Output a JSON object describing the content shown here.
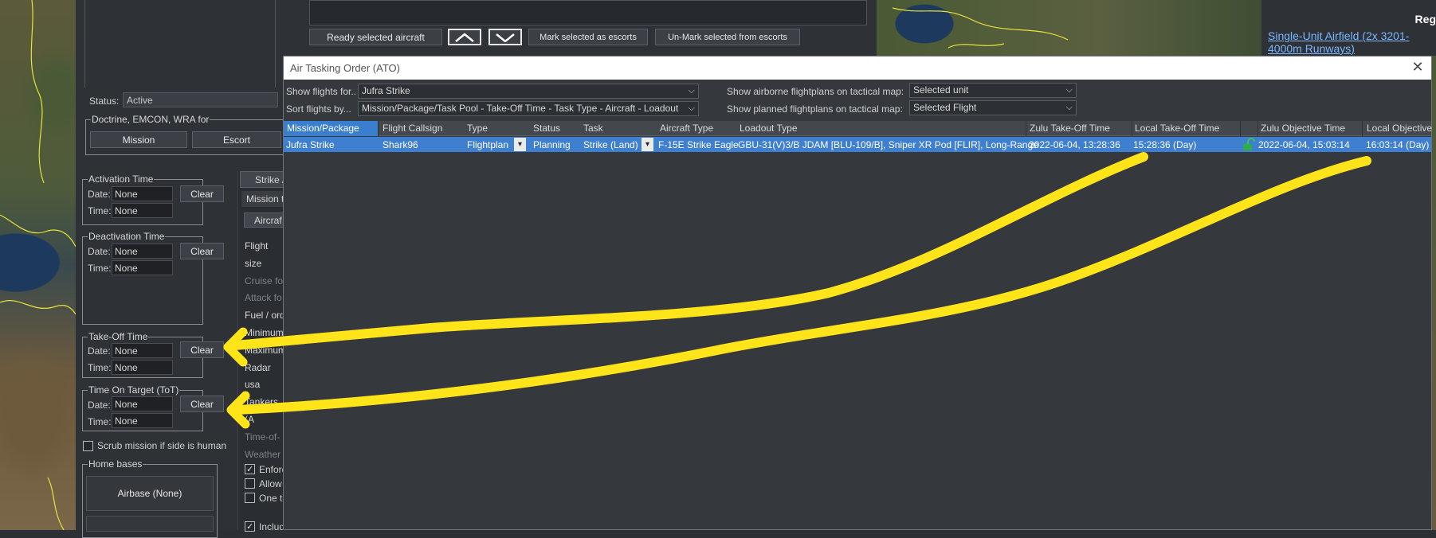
{
  "mission_editor": {
    "status_label": "Status:",
    "status_value": "Active",
    "doctrine_legend": "Doctrine, EMCON, WRA for",
    "mission_button": "Mission",
    "escort_button": "Escort",
    "activation": {
      "legend": "Activation Time",
      "date_label": "Date:",
      "date_value": "None",
      "time_label": "Time:",
      "time_value": "None",
      "clear": "Clear"
    },
    "deactivation": {
      "legend": "Deactivation Time",
      "date_label": "Date:",
      "date_value": "None",
      "time_label": "Time:",
      "time_value": "None",
      "clear": "Clear"
    },
    "takeoff": {
      "legend": "Take-Off Time",
      "date_label": "Date:",
      "date_value": "None",
      "time_label": "Time:",
      "time_value": "None",
      "clear": "Clear"
    },
    "tot": {
      "legend": "Time On Target (ToT)",
      "date_label": "Date:",
      "date_value": "None",
      "time_label": "Time:",
      "time_value": "None",
      "clear": "Clear"
    },
    "scrub_label": "Scrub mission if side is human",
    "home_bases_legend": "Home bases",
    "airbase_value": "Airbase (None)"
  },
  "mid_panel": {
    "tab_strike": "Strike /",
    "mission_t": "Mission t",
    "tab_aircraft": "Aircraf",
    "items": [
      "Flight size",
      "Cruise fo",
      "Attack fo",
      "Fuel / ord",
      "Minimum",
      "Maximum",
      "",
      "Radar usa",
      "Tankers (A",
      "Time-of-",
      "Weather"
    ],
    "check_enforce": "Enforc",
    "check_allow": "Allow",
    "check_one": "One t",
    "check_include": "Includ"
  },
  "top_panel": {
    "ready_button": "Ready selected aircraft",
    "mark_escorts": "Mark selected as escorts",
    "unmark_escorts": "Un-Mark selected from escorts"
  },
  "info_panel": {
    "heading": "Reg",
    "link": "Single-Unit Airfield (2x 3201-4000m Runways)"
  },
  "ato": {
    "title": "Air Tasking Order (ATO)",
    "show_flights_label": "Show flights for..",
    "show_flights_value": "Jufra Strike",
    "sort_label": "Sort flights by...",
    "sort_value": "Mission/Package/Task Pool - Take-Off Time - Task Type - Aircraft - Loadout",
    "airborne_label": "Show airborne flightplans on tactical map:",
    "airborne_value": "Selected unit",
    "planned_label": "Show planned flightplans on tactical map:",
    "planned_value": "Selected Flight",
    "columns": [
      "Mission/Package",
      "Flight Callsign",
      "Type",
      "Status",
      "Task",
      "Aircraft Type",
      "Loadout Type",
      "Zulu Take-Off Time",
      "Local Take-Off Time",
      "Zulu Objective Time",
      "Local Objective"
    ],
    "row": {
      "mission": "Jufra Strike",
      "callsign": "Shark96",
      "type": "Flightplan",
      "status": "Planning",
      "task": "Strike (Land)",
      "aircraft": "F-15E Strike Eagle",
      "loadout": "GBU-31(V)3/B JDAM [BLU-109/B], Sniper XR Pod [FLIR], Long-Range",
      "zulu_takeoff": "2022-06-04, 13:28:36",
      "local_takeoff": "15:28:36 (Day)",
      "zulu_objective": "2022-06-04, 15:03:14",
      "local_objective": "16:03:14 (Day)"
    }
  },
  "colors": {
    "annotation_arrow": "#ffe41a",
    "selection": "#3e7fd0"
  }
}
